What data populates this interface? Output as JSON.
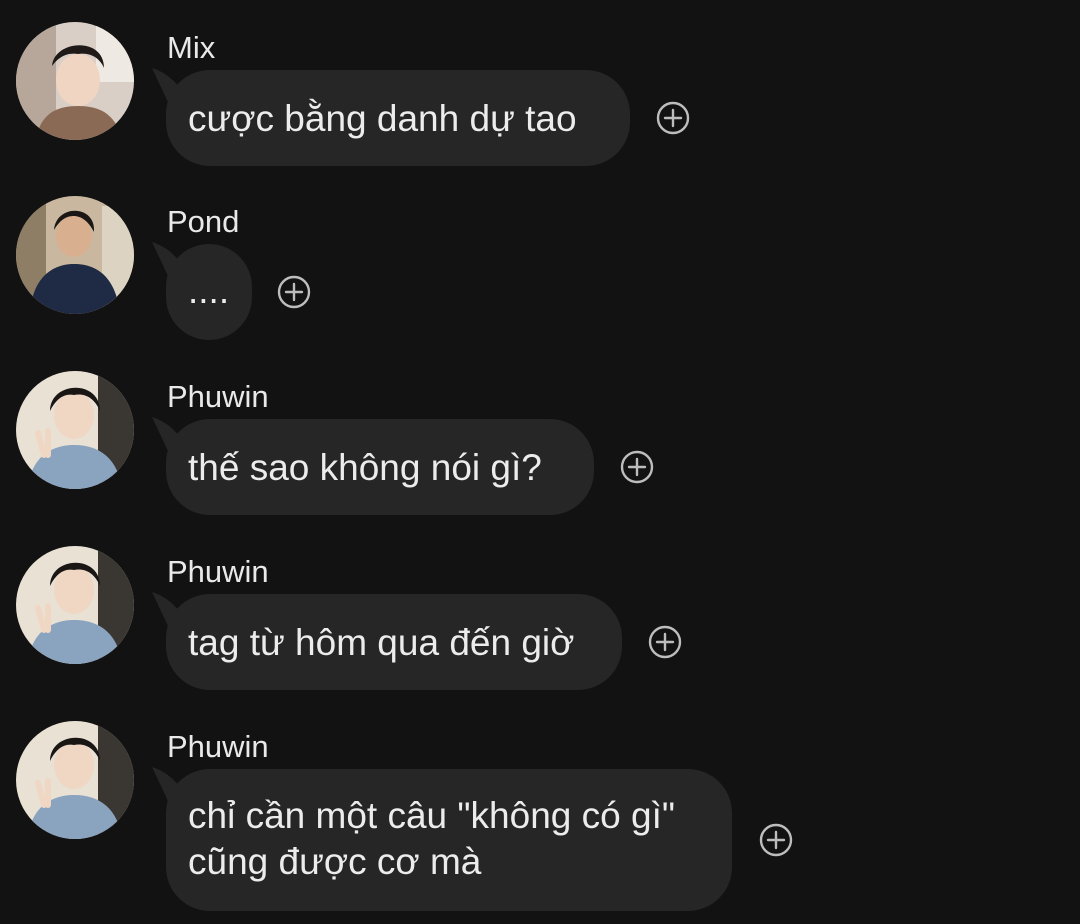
{
  "messages": [
    {
      "sender": "Mix",
      "lines": [
        "cược bằng danh dự tao"
      ],
      "avatar": "avatar-mix"
    },
    {
      "sender": "Pond",
      "lines": [
        "...."
      ],
      "avatar": "avatar-pond"
    },
    {
      "sender": "Phuwin",
      "lines": [
        "thế sao không nói gì?"
      ],
      "avatar": "avatar-phuwin"
    },
    {
      "sender": "Phuwin",
      "lines": [
        "tag từ hôm qua đến giờ"
      ],
      "avatar": "avatar-phuwin"
    },
    {
      "sender": "Phuwin",
      "lines": [
        "chỉ cần một câu \"không có gì\"",
        "cũng được cơ mà"
      ],
      "avatar": "avatar-phuwin"
    }
  ],
  "icons": {
    "react": "add-reaction-icon"
  },
  "colors": {
    "background": "#121212",
    "bubble": "#262626",
    "text": "#ececec",
    "icon": "#bdbdbd"
  }
}
